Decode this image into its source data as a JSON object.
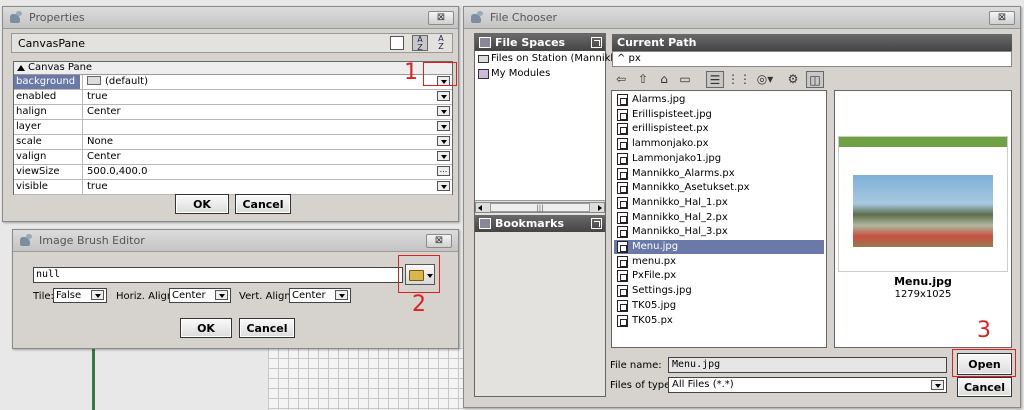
{
  "properties": {
    "title": "Properties",
    "close_label": "⊠",
    "component": "CanvasPane",
    "section": "Canvas Pane",
    "rows": [
      {
        "name": "background",
        "value": "(default)"
      },
      {
        "name": "enabled",
        "value": "true"
      },
      {
        "name": "halign",
        "value": "Center"
      },
      {
        "name": "layer",
        "value": ""
      },
      {
        "name": "scale",
        "value": "None"
      },
      {
        "name": "valign",
        "value": "Center"
      },
      {
        "name": "viewSize",
        "value": "500.0,400.0"
      },
      {
        "name": "visible",
        "value": "true"
      }
    ],
    "ok_label": "OK",
    "cancel_label": "Cancel"
  },
  "brush_editor": {
    "title": "Image Brush Editor",
    "close_label": "⊠",
    "path_value": "null",
    "tile_label": "Tile:",
    "tile_value": "False",
    "halign_label": "Horiz. Align:",
    "halign_value": "Center",
    "valign_label": "Vert. Align:",
    "valign_value": "Center",
    "ok_label": "OK",
    "cancel_label": "Cancel"
  },
  "file_chooser": {
    "title": "File Chooser",
    "close_label": "⊠",
    "file_spaces_label": "File Spaces",
    "spaces": [
      "Files on Station (Mannikko)",
      "My Modules"
    ],
    "scroll_mid": "|||",
    "bookmarks_label": "Bookmarks",
    "current_path_label": "Current Path",
    "current_path_value": "^ px",
    "files": [
      "Alarms.jpg",
      "Erillispisteet.jpg",
      "erillispisteet.px",
      "lammonjako.px",
      "Lammonjako1.jpg",
      "Mannikko_Alarms.px",
      "Mannikko_Asetukset.px",
      "Mannikko_Hal_1.px",
      "Mannikko_Hal_2.px",
      "Mannikko_Hal_3.px",
      "Menu.jpg",
      "menu.px",
      "PxFile.px",
      "Settings.jpg",
      "TK05.jpg",
      "TK05.px"
    ],
    "selected_index": 10,
    "preview_name": "Menu.jpg",
    "preview_size": "1279x1025",
    "file_name_label": "File name:",
    "file_name_value": "Menu.jpg",
    "file_type_label": "Files of type:",
    "file_type_value": "All Files (*.*)",
    "open_label": "Open",
    "cancel_label": "Cancel"
  },
  "annotations": {
    "one": "1",
    "two": "2",
    "three": "3"
  },
  "colors": {
    "selection": "#6b79a8",
    "annotation": "#e02020",
    "panel_header": "#555555"
  }
}
